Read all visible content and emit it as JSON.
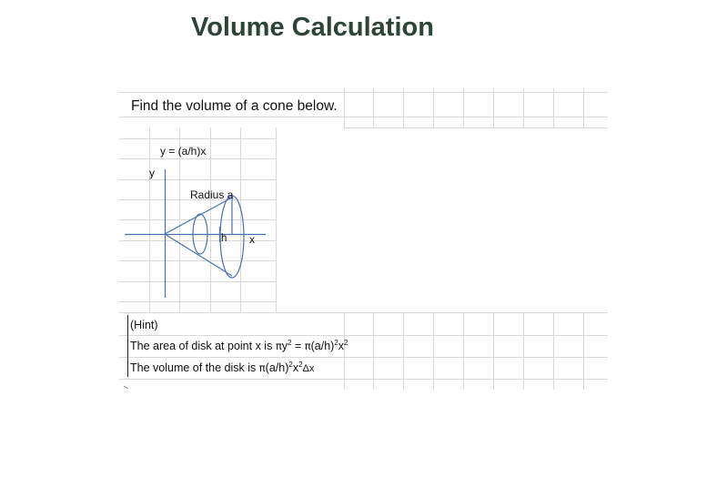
{
  "title": "Volume Calculation",
  "question": "Find the volume of a cone below.",
  "diagram": {
    "equation": "y = (a/h)x",
    "y_axis_label": "y",
    "x_axis_label": "x",
    "radius_label": "Radius a",
    "height_label": "h"
  },
  "hint": {
    "heading": "(Hint)",
    "area": {
      "prefix": "The area of disk at point x is ",
      "pi1": "π",
      "y": "y",
      "sq1": "2",
      "mid": " = ",
      "pi2": "π",
      "paren": "(a/h)",
      "sq2": "2",
      "x": "x",
      "sq3": "2"
    },
    "volume": {
      "prefix": "The volume of the disk is ",
      "pi": "π",
      "paren": "(a/h)",
      "sq1": "2",
      "x": "x",
      "sq2": "2",
      "delta": "Δx"
    }
  },
  "colors": {
    "title": "#2e4438",
    "gridline": "#d9d9d9",
    "diagram_line": "#4a72b0"
  }
}
